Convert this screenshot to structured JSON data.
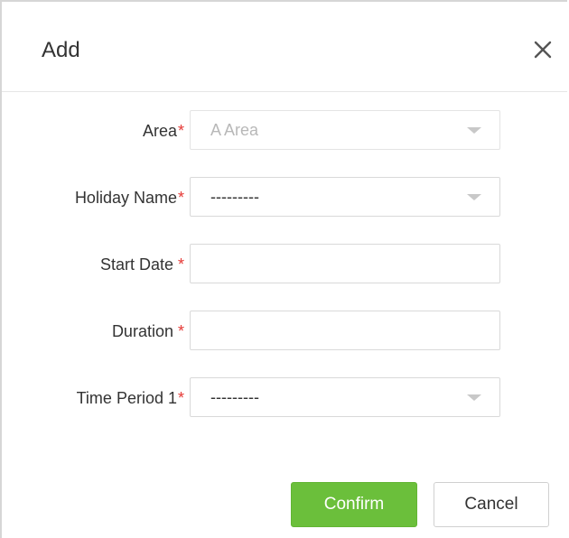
{
  "dialog": {
    "title": "Add",
    "close_icon": "close-icon"
  },
  "form": {
    "area": {
      "label": "Area",
      "required_mark": "*",
      "value": "A Area",
      "disabled": true
    },
    "holiday_name": {
      "label": "Holiday Name",
      "required_mark": "*",
      "value": "---------"
    },
    "start_date": {
      "label": "Start Date",
      "required_mark": "*",
      "value": ""
    },
    "duration": {
      "label": "Duration",
      "required_mark": "*",
      "value": ""
    },
    "time_period_1": {
      "label": "Time Period 1",
      "required_mark": "*",
      "value": "---------"
    }
  },
  "buttons": {
    "confirm": "Confirm",
    "cancel": "Cancel"
  },
  "colors": {
    "confirm_bg": "#6bbf3b",
    "required": "#e53935"
  }
}
